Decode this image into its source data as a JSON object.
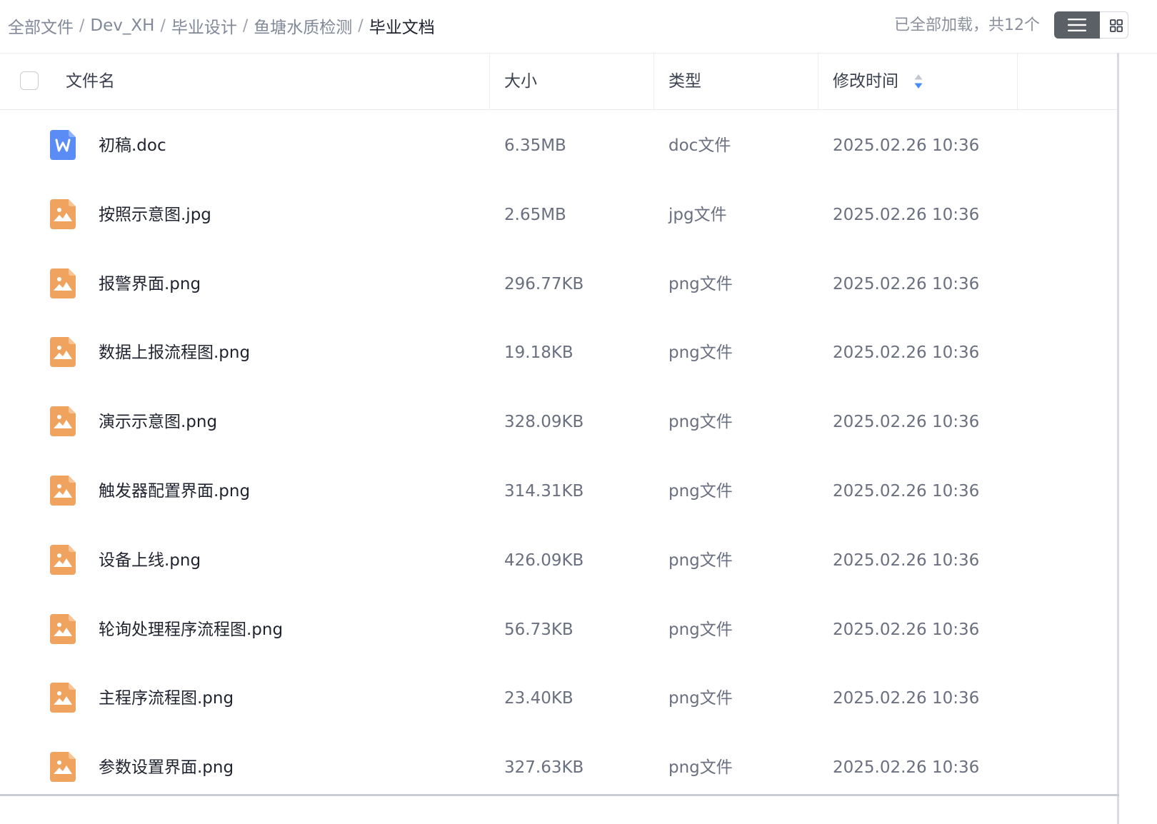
{
  "breadcrumb": {
    "items": [
      "全部文件",
      "Dev_XH",
      "毕业设计",
      "鱼塘水质检测"
    ],
    "separator": "/",
    "current": "毕业文档"
  },
  "status": {
    "loaded_text": "已全部加载，共12个"
  },
  "table": {
    "columns": {
      "name": "文件名",
      "size": "大小",
      "type": "类型",
      "modified": "修改时间"
    },
    "rows": [
      {
        "name": "初稿.doc",
        "size": "6.35MB",
        "type": "doc文件",
        "modified": "2025.02.26 10:36",
        "icon": "word-doc-icon"
      },
      {
        "name": "按照示意图.jpg",
        "size": "2.65MB",
        "type": "jpg文件",
        "modified": "2025.02.26 10:36",
        "icon": "image-file-icon"
      },
      {
        "name": "报警界面.png",
        "size": "296.77KB",
        "type": "png文件",
        "modified": "2025.02.26 10:36",
        "icon": "image-file-icon"
      },
      {
        "name": "数据上报流程图.png",
        "size": "19.18KB",
        "type": "png文件",
        "modified": "2025.02.26 10:36",
        "icon": "image-file-icon"
      },
      {
        "name": "演示示意图.png",
        "size": "328.09KB",
        "type": "png文件",
        "modified": "2025.02.26 10:36",
        "icon": "image-file-icon"
      },
      {
        "name": "触发器配置界面.png",
        "size": "314.31KB",
        "type": "png文件",
        "modified": "2025.02.26 10:36",
        "icon": "image-file-icon"
      },
      {
        "name": "设备上线.png",
        "size": "426.09KB",
        "type": "png文件",
        "modified": "2025.02.26 10:36",
        "icon": "image-file-icon"
      },
      {
        "name": "轮询处理程序流程图.png",
        "size": "56.73KB",
        "type": "png文件",
        "modified": "2025.02.26 10:36",
        "icon": "image-file-icon"
      },
      {
        "name": "主程序流程图.png",
        "size": "23.40KB",
        "type": "png文件",
        "modified": "2025.02.26 10:36",
        "icon": "image-file-icon"
      },
      {
        "name": "参数设置界面.png",
        "size": "327.63KB",
        "type": "png文件",
        "modified": "2025.02.26 10:36",
        "icon": "image-file-icon"
      }
    ]
  },
  "icons": {
    "list_view": "list-view-icon",
    "grid_view": "grid-view-icon",
    "sort": "sort-icon"
  },
  "colors": {
    "word_icon": "#5b8cf5",
    "image_icon": "#f0a35e",
    "sort_active": "#4a8cf7",
    "list_view_button": "#5b5f66"
  }
}
